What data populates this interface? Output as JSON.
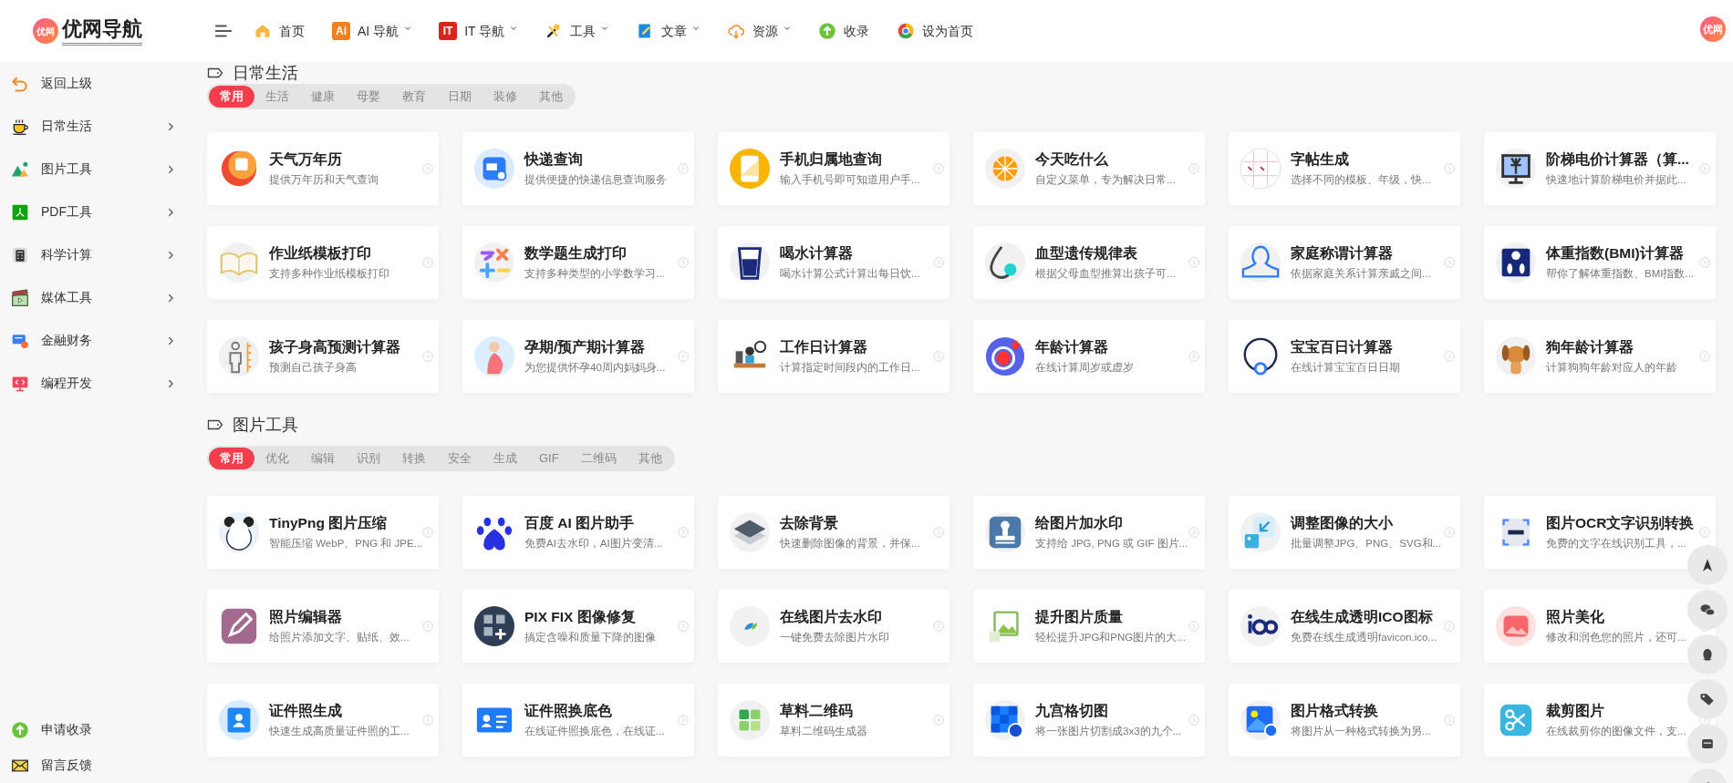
{
  "header": {
    "logo_badge": "优网",
    "logo_title": "优网导航",
    "avatar": "优网",
    "nav": [
      {
        "label": "首页",
        "dropdown": false
      },
      {
        "label": "AI 导航",
        "badge": "Ai",
        "color": "#f0801e",
        "dropdown": true
      },
      {
        "label": "IT 导航",
        "badge": "IT",
        "color": "#d8261d",
        "dropdown": true
      },
      {
        "label": "工具",
        "dropdown": true
      },
      {
        "label": "文章",
        "dropdown": true
      },
      {
        "label": "资源",
        "dropdown": true
      },
      {
        "label": "收录",
        "dropdown": false
      },
      {
        "label": "设为首页",
        "dropdown": false
      }
    ]
  },
  "sidebar": {
    "items": [
      {
        "label": "返回上级",
        "expandable": false
      },
      {
        "label": "日常生活",
        "expandable": true
      },
      {
        "label": "图片工具",
        "expandable": true
      },
      {
        "label": "PDF工具",
        "expandable": true
      },
      {
        "label": "科学计算",
        "expandable": true
      },
      {
        "label": "媒体工具",
        "expandable": true
      },
      {
        "label": "金融财务",
        "expandable": true
      },
      {
        "label": "编程开发",
        "expandable": true
      }
    ],
    "footer": [
      {
        "label": "申请收录"
      },
      {
        "label": "留言反馈"
      }
    ]
  },
  "sections": [
    {
      "title": "日常生活",
      "tabs": [
        {
          "label": "常用",
          "selected": true
        },
        {
          "label": "生活",
          "selected": false
        },
        {
          "label": "健康",
          "selected": false
        },
        {
          "label": "母婴",
          "selected": false
        },
        {
          "label": "教育",
          "selected": false
        },
        {
          "label": "日期",
          "selected": false
        },
        {
          "label": "装修",
          "selected": false
        },
        {
          "label": "其他",
          "selected": false
        }
      ],
      "cards": [
        {
          "title": "天气万年历",
          "desc": "提供万年历和天气查询"
        },
        {
          "title": "快递查询",
          "desc": "提供便捷的快递信息查询服务"
        },
        {
          "title": "手机归属地查询",
          "desc": "输入手机号即可知道用户手..."
        },
        {
          "title": "今天吃什么",
          "desc": "自定义菜单，专为解决日常..."
        },
        {
          "title": "字帖生成",
          "desc": "选择不同的模板、年级，快..."
        },
        {
          "title": "阶梯电价计算器（算...",
          "desc": "快速地计算阶梯电价并据此..."
        },
        {
          "title": "作业纸模板打印",
          "desc": "支持多种作业纸模板打印"
        },
        {
          "title": "数学题生成打印",
          "desc": "支持多种类型的小学数学习..."
        },
        {
          "title": "喝水计算器",
          "desc": "喝水计算公式计算出每日饮..."
        },
        {
          "title": "血型遗传规律表",
          "desc": "根据父母血型推算出孩子可..."
        },
        {
          "title": "家庭称谓计算器",
          "desc": "依据家庭关系计算亲戚之间..."
        },
        {
          "title": "体重指数(BMI)计算器",
          "desc": "帮你了解体重指数、BMI指数..."
        },
        {
          "title": "孩子身高预测计算器",
          "desc": "预测自己孩子身高"
        },
        {
          "title": "孕期/预产期计算器",
          "desc": "为您提供怀孕40周内妈妈身..."
        },
        {
          "title": "工作日计算器",
          "desc": "计算指定时间段内的工作日..."
        },
        {
          "title": "年龄计算器",
          "desc": "在线计算周岁或虚岁"
        },
        {
          "title": "宝宝百日计算器",
          "desc": "在线计算宝宝百日日期"
        },
        {
          "title": "狗年龄计算器",
          "desc": "计算狗狗年龄对应人的年龄"
        }
      ]
    },
    {
      "title": "图片工具",
      "tabs": [
        {
          "label": "常用",
          "selected": true
        },
        {
          "label": "优化",
          "selected": false
        },
        {
          "label": "编辑",
          "selected": false
        },
        {
          "label": "识别",
          "selected": false
        },
        {
          "label": "转换",
          "selected": false
        },
        {
          "label": "安全",
          "selected": false
        },
        {
          "label": "生成",
          "selected": false
        },
        {
          "label": "GIF",
          "selected": false
        },
        {
          "label": "二维码",
          "selected": false
        },
        {
          "label": "其他",
          "selected": false
        }
      ],
      "cards": [
        {
          "title": "TinyPng 图片压缩",
          "desc": "智能压缩 WebP、PNG 和 JPE..."
        },
        {
          "title": "百度 AI 图片助手",
          "desc": "免费AI去水印，AI图片变清..."
        },
        {
          "title": "去除背景",
          "desc": "快速删除图像的背景，并保..."
        },
        {
          "title": "给图片加水印",
          "desc": "支持给 JPG, PNG 或 GIF 图片..."
        },
        {
          "title": "调整图像的大小",
          "desc": "批量调整JPG、PNG、SVG和..."
        },
        {
          "title": "图片OCR文字识别转换",
          "desc": "免费的文字在线识别工具，..."
        },
        {
          "title": "照片编辑器",
          "desc": "给照片添加文字、贴纸、效..."
        },
        {
          "title": "PIX FIX 图像修复",
          "desc": "搞定含噪和质量下降的图像"
        },
        {
          "title": "在线图片去水印",
          "desc": "一键免费去除图片水印"
        },
        {
          "title": "提升图片质量",
          "desc": "轻松提升JPG和PNG图片的大..."
        },
        {
          "title": "在线生成透明ICO图标",
          "desc": "免费在线生成透明favicon.ico..."
        },
        {
          "title": "照片美化",
          "desc": "修改和润色您的照片，还可..."
        },
        {
          "title": "证件照生成",
          "desc": "快速生成高质量证件照的工..."
        },
        {
          "title": "证件照换底色",
          "desc": "在线证件照换底色，在线证..."
        },
        {
          "title": "草料二维码",
          "desc": "草料二维码生成器"
        },
        {
          "title": "九宫格切图",
          "desc": "将一张图片切割成3x3的九个..."
        },
        {
          "title": "图片格式转换",
          "desc": "将图片从一种格式转换为另..."
        },
        {
          "title": "裁剪图片",
          "desc": "在线裁剪你的图像文件，支..."
        }
      ]
    }
  ]
}
